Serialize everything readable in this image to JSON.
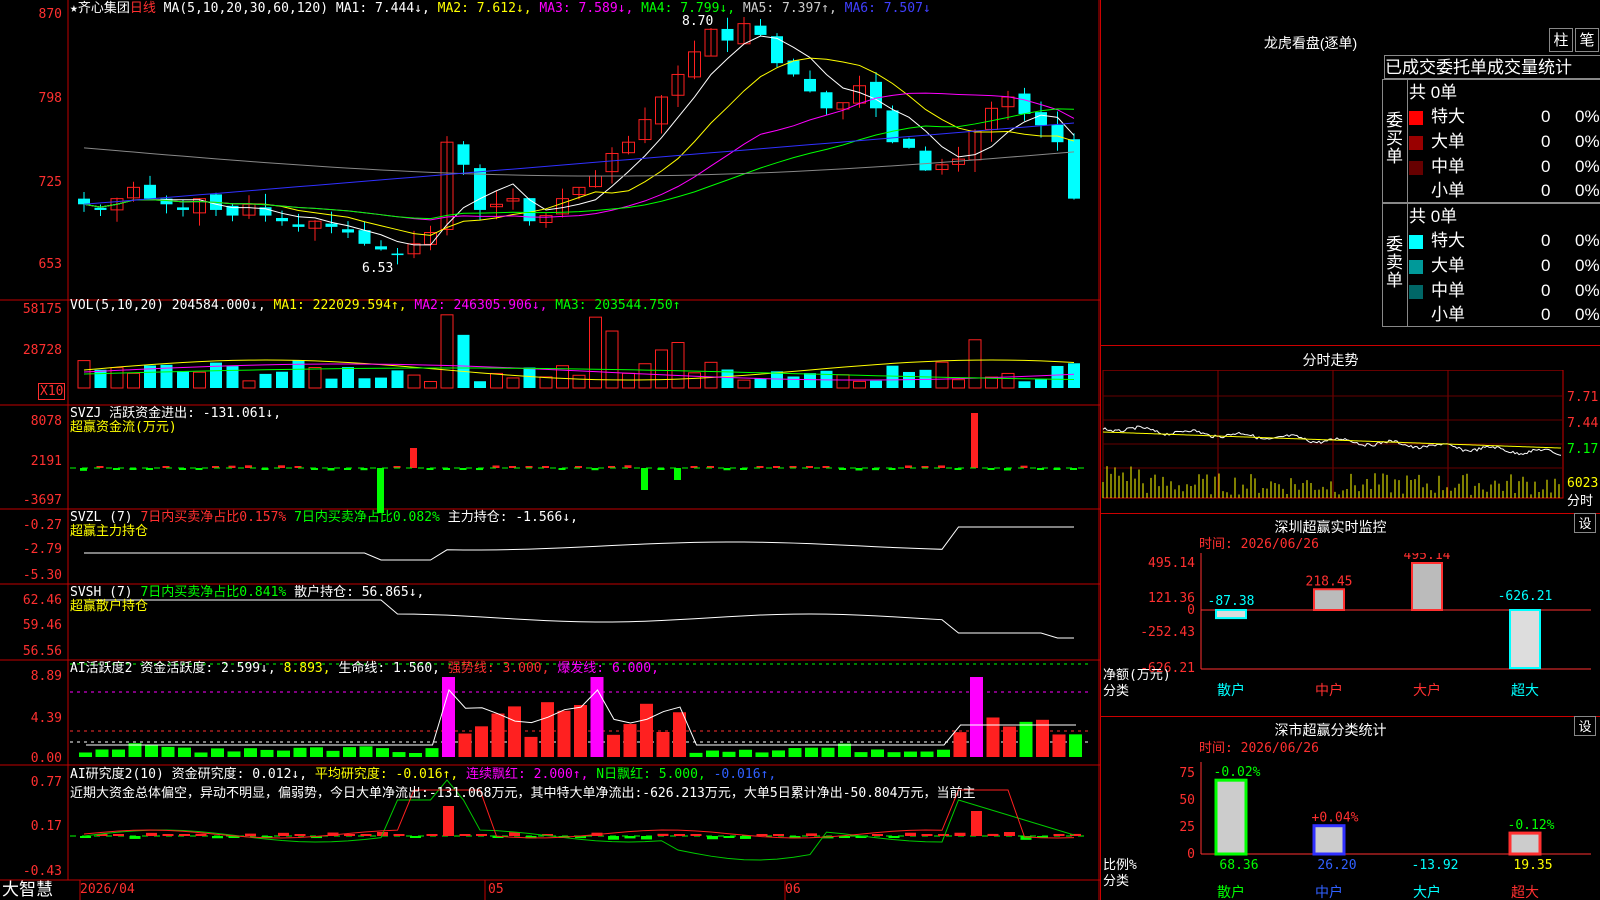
{
  "colors": {
    "up": "#ff2020",
    "down": "#00ffff",
    "ma1": "#ffffff",
    "ma2": "#ffff00",
    "ma3": "#ff00ff",
    "ma4": "#00ff00",
    "ma5": "#888888",
    "ma6": "#3030ff",
    "axis": "#c00000",
    "price": "#ff3030"
  },
  "header": {
    "star_title": "★齐心集团",
    "period": "日线",
    "ma_prefix": "MA(5,10,20,30,60,120)",
    "ma_items": [
      {
        "label": "MA1: 7.444↓,",
        "color": "#ffffff"
      },
      {
        "label": "MA2: 7.612↓,",
        "color": "#ffff00"
      },
      {
        "label": "MA3: 7.589↓,",
        "color": "#ff00ff"
      },
      {
        "label": "MA4: 7.799↓,",
        "color": "#00ff00"
      },
      {
        "label": "MA5: 7.397↑,",
        "color": "#cccccc"
      },
      {
        "label": "MA6: 7.507↓",
        "color": "#4040ff"
      }
    ]
  },
  "price_panel": {
    "ticks": [
      "870",
      "798",
      "725",
      "653"
    ],
    "high_label": "8.70",
    "low_label": "6.53"
  },
  "vol_panel": {
    "title": "VOL(5,10,20)",
    "value": "204584.000↓,",
    "ma1": "MA1: 222029.594↑,",
    "ma2": "MA2: 246305.906↓,",
    "ma3": "MA3: 203544.750↑",
    "ticks": [
      "58175",
      "28728"
    ],
    "unit": "X10"
  },
  "svzj_panel": {
    "title": "SVZJ  活跃资金进出: -131.061↓,",
    "subtitle": "超赢资金流(万元)",
    "ticks": [
      "8078",
      "2191",
      "-3697"
    ]
  },
  "svzl_panel": {
    "title": "SVZL (7)",
    "item1": "7日内买卖净占比0.157%",
    "item2": "7日内买卖净占比0.082%",
    "item3": "主力持仓: -1.566↓,",
    "subtitle": "超赢主力持仓",
    "ticks": [
      "-0.27",
      "-2.79",
      "-5.30"
    ]
  },
  "svsh_panel": {
    "title": "SVSH (7)",
    "item1": "7日内买卖净占比0.841%",
    "item2": "散户持仓: 56.865↓,",
    "subtitle": "超赢散户持仓",
    "ticks": [
      "62.46",
      "59.46",
      "56.56"
    ]
  },
  "ai1_panel": {
    "title": "AI活跃度2",
    "item1": "资金活跃度: 2.599↓,",
    "item2": "8.893,",
    "item3": "生命线: 1.560,",
    "item4": "强势线: 3.000,",
    "item5": "爆发线: 6.000,",
    "ticks": [
      "8.89",
      "4.39",
      "0.00"
    ]
  },
  "ai2_panel": {
    "title": "AI研究度2(10)",
    "item1": "资金研究度: 0.012↓,",
    "item2": "平均研究度: -0.016↑,",
    "item3": "连续飘红: 2.000↑,",
    "item4": "N日飘红: 5.000,",
    "item5": "-0.016↑,",
    "comment": "近期大资金总体偏空，异动不明显，偏弱势，今日大单净流出:-131.068万元，其中特大单净流出:-626.213万元，大单5日累计净出-50.804万元，当前主",
    "ticks": [
      "0.77",
      "0.17",
      "-0.43"
    ]
  },
  "bottom": {
    "brand": "大智慧",
    "dates": [
      "2026/04",
      "05",
      "06"
    ]
  },
  "right": {
    "lhb_title": "龙虎看盘(逐单)",
    "tab1": "柱",
    "tab2": "笔",
    "subtitle": "已成交委托单成交量统计",
    "buy_label": "委买单",
    "sell_label": "委卖单",
    "buy_total": "共 0单",
    "sell_total": "共 0单",
    "buy_rows": [
      {
        "name": "特大",
        "count": "0",
        "pct": "0%",
        "color": "#ff0000"
      },
      {
        "name": "大单",
        "count": "0",
        "pct": "0%",
        "color": "#990000"
      },
      {
        "name": "中单",
        "count": "0",
        "pct": "0%",
        "color": "#660000"
      },
      {
        "name": "小单",
        "count": "0",
        "pct": "0%",
        "color": "#000000"
      }
    ],
    "sell_rows": [
      {
        "name": "特大",
        "count": "0",
        "pct": "0%",
        "color": "#00ffff"
      },
      {
        "name": "大单",
        "count": "0",
        "pct": "0%",
        "color": "#009999"
      },
      {
        "name": "中单",
        "count": "0",
        "pct": "0%",
        "color": "#006666"
      },
      {
        "name": "小单",
        "count": "0",
        "pct": "0%",
        "color": "#000000"
      }
    ],
    "fs_title": "分时走势",
    "fs_ticks": [
      "7.71",
      "7.44",
      "7.17",
      "6023"
    ],
    "fs_label": "分时",
    "sz_title": "深圳超赢实时监控",
    "sz_set": "设",
    "sz_time": "时间: 2026/06/26",
    "sz_ticks": [
      "495.14",
      "121.36",
      "0",
      "-252.43",
      "-626.21"
    ],
    "sz_ylabel": "净额(万元)",
    "sz_xlabel": "分类",
    "sz_bars": [
      {
        "cat": "散户",
        "value": -87.38,
        "label": "-87.38",
        "color": "#00ffff"
      },
      {
        "cat": "中户",
        "value": 218.45,
        "label": "218.45",
        "color": "#ff3030"
      },
      {
        "cat": "大户",
        "value": 495.14,
        "label": "495.14",
        "color": "#ff3030"
      },
      {
        "cat": "超大",
        "value": -626.21,
        "label": "-626.21",
        "color": "#00ffff"
      }
    ],
    "sc_title": "深市超赢分类统计",
    "sc_set": "设",
    "sc_time": "时间: 2026/06/26",
    "sc_ticks": [
      "75",
      "50",
      "25",
      "0"
    ],
    "sc_ylabel": "比例%",
    "sc_xlabel": "分类",
    "sc_bars": [
      {
        "cat": "散户",
        "value": 68.36,
        "label": "68.36",
        "change": "-0.02%",
        "bar": "#00ff00",
        "changeColor": "#00ff00"
      },
      {
        "cat": "中户",
        "value": 26.2,
        "label": "26.20",
        "change": "+0.04%",
        "bar": "#3030ff",
        "changeColor": "#ff3030"
      },
      {
        "cat": "大户",
        "value": -13.92,
        "label": "-13.92",
        "change": "",
        "bar": "#ffffff",
        "changeColor": "#00ff00"
      },
      {
        "cat": "超大",
        "value": 19.35,
        "label": "19.35",
        "change": "-0.12%",
        "bar": "#ff3030",
        "changeColor": "#00ff00"
      }
    ]
  }
}
